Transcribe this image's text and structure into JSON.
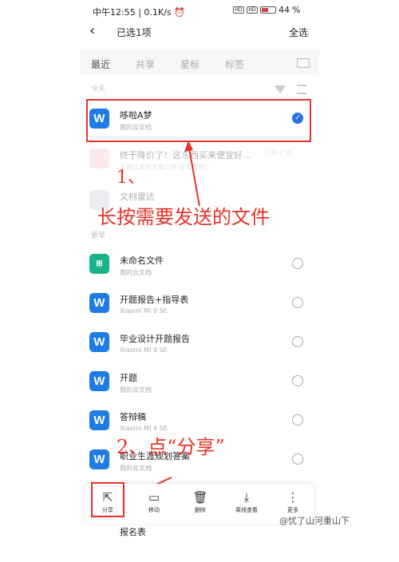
{
  "status": {
    "time": "中午12:55",
    "speed": "0.1K/s",
    "sig1": "HD",
    "sig2": "HD",
    "battery": "44"
  },
  "header": {
    "back_icon": "chevron-left-icon",
    "title": "已选1项",
    "select_all": "全选"
  },
  "tabs": [
    "最近",
    "共享",
    "星标",
    "标签"
  ],
  "sections": {
    "today": "今天",
    "earlier": "更早"
  },
  "files_today": [
    {
      "name": "哆啦A梦",
      "sub": "我的云文档",
      "checked": true
    },
    {
      "name": "终于降价了！这东西买来便宜好...",
      "sub": "从微信发现文章分享·好东西来！",
      "tag": "小米·广告",
      "faded": true
    },
    {
      "name": "文档雷达",
      "sub": "",
      "faded": true
    }
  ],
  "files_earlier": [
    {
      "name": "未命名文件",
      "sub": "我的云文档",
      "icon": "green"
    },
    {
      "name": "开题报告+指导表",
      "sub": "Xiaomi MI 9 SE"
    },
    {
      "name": "毕业设计开题报告",
      "sub": "Xiaomi MI 9 SE"
    },
    {
      "name": "开题",
      "sub": "我的云文档"
    },
    {
      "name": "答辩稿",
      "sub": "Xiaomi MI 9 SE"
    },
    {
      "name": "职业生涯规划答案",
      "sub": "我的云文档"
    }
  ],
  "annotations": {
    "step1": "1、",
    "step1_text": "长按需要发送的文件",
    "step2": "2、点“分享”"
  },
  "toolbar": [
    {
      "label": "分享",
      "icon": "share-icon",
      "glyph": "⇱"
    },
    {
      "label": "移动",
      "icon": "folder-move-icon",
      "glyph": "▭"
    },
    {
      "label": "删除",
      "icon": "trash-icon",
      "glyph": "🗑"
    },
    {
      "label": "离线查看",
      "icon": "download-icon",
      "glyph": "⤓"
    },
    {
      "label": "更多",
      "icon": "more-icon",
      "glyph": "⋮"
    }
  ],
  "partial_row": "报名表",
  "watermark": "@忧了山河重山下",
  "colors": {
    "accent": "#2a6ee6",
    "annotation": "#e53327",
    "word_blue": "#1f7ce4"
  }
}
